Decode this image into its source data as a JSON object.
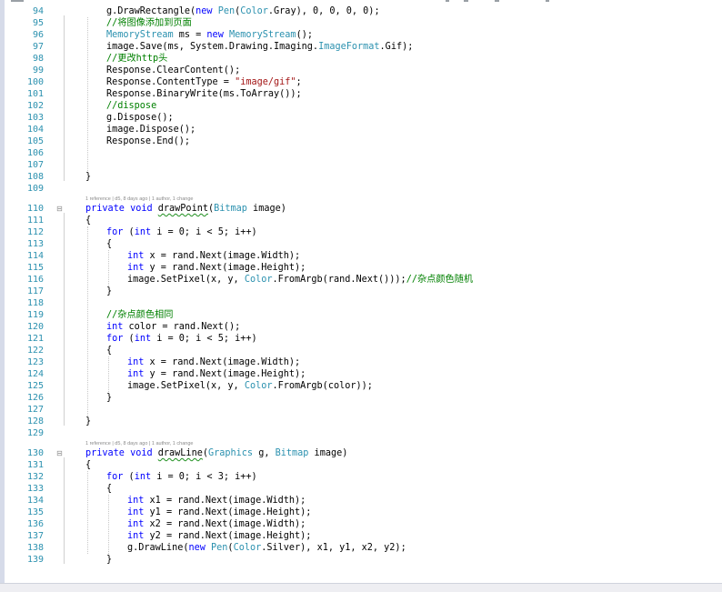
{
  "editor": {
    "lines": [
      {
        "n": "94",
        "indent": 2,
        "tokens": [
          {
            "t": "g.DrawRectangle("
          },
          {
            "t": "new",
            "c": "kw"
          },
          {
            "t": " "
          },
          {
            "t": "Pen",
            "c": "ty"
          },
          {
            "t": "("
          },
          {
            "t": "Color",
            "c": "ty"
          },
          {
            "t": ".Gray), 0, 0, 0, 0);"
          }
        ]
      },
      {
        "n": "95",
        "indent": 2,
        "tokens": [
          {
            "t": "//将图像添加到页面",
            "c": "cm"
          }
        ]
      },
      {
        "n": "96",
        "indent": 2,
        "tokens": [
          {
            "t": "MemoryStream",
            "c": "ty"
          },
          {
            "t": " ms = "
          },
          {
            "t": "new",
            "c": "kw"
          },
          {
            "t": " "
          },
          {
            "t": "MemoryStream",
            "c": "ty"
          },
          {
            "t": "();"
          }
        ]
      },
      {
        "n": "97",
        "indent": 2,
        "tokens": [
          {
            "t": "image.Save(ms, System.Drawing.Imaging."
          },
          {
            "t": "ImageFormat",
            "c": "ty"
          },
          {
            "t": ".Gif);"
          }
        ]
      },
      {
        "n": "98",
        "indent": 2,
        "tokens": [
          {
            "t": "//更改http头",
            "c": "cm"
          }
        ]
      },
      {
        "n": "99",
        "indent": 2,
        "tokens": [
          {
            "t": "Response.ClearContent();"
          }
        ]
      },
      {
        "n": "100",
        "indent": 2,
        "tokens": [
          {
            "t": "Response.ContentType = "
          },
          {
            "t": "\"image/gif\"",
            "c": "str"
          },
          {
            "t": ";"
          }
        ]
      },
      {
        "n": "101",
        "indent": 2,
        "tokens": [
          {
            "t": "Response.BinaryWrite(ms.ToArray());"
          }
        ]
      },
      {
        "n": "102",
        "indent": 2,
        "tokens": [
          {
            "t": "//dispose",
            "c": "cm"
          }
        ]
      },
      {
        "n": "103",
        "indent": 2,
        "tokens": [
          {
            "t": "g.Dispose();"
          }
        ]
      },
      {
        "n": "104",
        "indent": 2,
        "tokens": [
          {
            "t": "image.Dispose();"
          }
        ]
      },
      {
        "n": "105",
        "indent": 2,
        "tokens": [
          {
            "t": "Response.End();"
          }
        ]
      },
      {
        "n": "106",
        "indent": 0,
        "tokens": []
      },
      {
        "n": "107",
        "indent": 0,
        "tokens": []
      },
      {
        "n": "108",
        "indent": 1,
        "tokens": [
          {
            "t": "}"
          }
        ]
      },
      {
        "n": "109",
        "indent": 0,
        "tokens": []
      },
      {
        "n": "110",
        "indent": 1,
        "fold": "⊟",
        "lens": "1 reference | d5, 8 days ago | 1 author, 1 change",
        "tokens": [
          {
            "t": "private",
            "c": "kw"
          },
          {
            "t": " "
          },
          {
            "t": "void",
            "c": "kw"
          },
          {
            "t": " "
          },
          {
            "t": "drawPoint",
            "c": "sq-green"
          },
          {
            "t": "("
          },
          {
            "t": "Bitmap",
            "c": "ty"
          },
          {
            "t": " image)"
          }
        ]
      },
      {
        "n": "111",
        "indent": 1,
        "tokens": [
          {
            "t": "{"
          }
        ]
      },
      {
        "n": "112",
        "indent": 2,
        "tokens": [
          {
            "t": "for",
            "c": "kw"
          },
          {
            "t": " ("
          },
          {
            "t": "int",
            "c": "kw"
          },
          {
            "t": " i = 0; i < 5; i++)"
          }
        ]
      },
      {
        "n": "113",
        "indent": 2,
        "tokens": [
          {
            "t": "{"
          }
        ]
      },
      {
        "n": "114",
        "indent": 3,
        "tokens": [
          {
            "t": "int",
            "c": "kw"
          },
          {
            "t": " x = rand.Next(image.Width);"
          }
        ]
      },
      {
        "n": "115",
        "indent": 3,
        "tokens": [
          {
            "t": "int",
            "c": "kw"
          },
          {
            "t": " y = rand.Next(image.Height);"
          }
        ]
      },
      {
        "n": "116",
        "indent": 3,
        "tokens": [
          {
            "t": "image.SetPixel(x, y, "
          },
          {
            "t": "Color",
            "c": "ty"
          },
          {
            "t": ".FromArgb(rand.Next()));"
          },
          {
            "t": "//杂点颜色随机",
            "c": "cm"
          }
        ]
      },
      {
        "n": "117",
        "indent": 2,
        "tokens": [
          {
            "t": "}"
          }
        ]
      },
      {
        "n": "118",
        "indent": 0,
        "tokens": []
      },
      {
        "n": "119",
        "indent": 2,
        "tokens": [
          {
            "t": "//杂点颜色相同",
            "c": "cm"
          }
        ]
      },
      {
        "n": "120",
        "indent": 2,
        "tokens": [
          {
            "t": "int",
            "c": "kw"
          },
          {
            "t": " color = rand.Next();"
          }
        ]
      },
      {
        "n": "121",
        "indent": 2,
        "tokens": [
          {
            "t": "for",
            "c": "kw"
          },
          {
            "t": " ("
          },
          {
            "t": "int",
            "c": "kw"
          },
          {
            "t": " i = 0; i < 5; i++)"
          }
        ]
      },
      {
        "n": "122",
        "indent": 2,
        "tokens": [
          {
            "t": "{"
          }
        ]
      },
      {
        "n": "123",
        "indent": 3,
        "tokens": [
          {
            "t": "int",
            "c": "kw"
          },
          {
            "t": " x = rand.Next(image.Width);"
          }
        ]
      },
      {
        "n": "124",
        "indent": 3,
        "tokens": [
          {
            "t": "int",
            "c": "kw"
          },
          {
            "t": " y = rand.Next(image.Height);"
          }
        ]
      },
      {
        "n": "125",
        "indent": 3,
        "tokens": [
          {
            "t": "image.SetPixel(x, y, "
          },
          {
            "t": "Color",
            "c": "ty"
          },
          {
            "t": ".FromArgb(color));"
          }
        ]
      },
      {
        "n": "126",
        "indent": 2,
        "tokens": [
          {
            "t": "}"
          }
        ]
      },
      {
        "n": "127",
        "indent": 0,
        "tokens": []
      },
      {
        "n": "128",
        "indent": 1,
        "tokens": [
          {
            "t": "}"
          }
        ]
      },
      {
        "n": "129",
        "indent": 0,
        "tokens": []
      },
      {
        "n": "130",
        "indent": 1,
        "fold": "⊟",
        "lens": "1 reference | d5, 8 days ago | 1 author, 1 change",
        "tokens": [
          {
            "t": "private",
            "c": "kw"
          },
          {
            "t": " "
          },
          {
            "t": "void",
            "c": "kw"
          },
          {
            "t": " "
          },
          {
            "t": "drawLine",
            "c": "sq-green"
          },
          {
            "t": "("
          },
          {
            "t": "Graphics",
            "c": "ty"
          },
          {
            "t": " g, "
          },
          {
            "t": "Bitmap",
            "c": "ty"
          },
          {
            "t": " image)"
          }
        ]
      },
      {
        "n": "131",
        "indent": 1,
        "tokens": [
          {
            "t": "{"
          }
        ]
      },
      {
        "n": "132",
        "indent": 2,
        "tokens": [
          {
            "t": "for",
            "c": "kw"
          },
          {
            "t": " ("
          },
          {
            "t": "int",
            "c": "kw"
          },
          {
            "t": " i = 0; i < 3; i++)"
          }
        ]
      },
      {
        "n": "133",
        "indent": 2,
        "tokens": [
          {
            "t": "{"
          }
        ]
      },
      {
        "n": "134",
        "indent": 3,
        "tokens": [
          {
            "t": "int",
            "c": "kw"
          },
          {
            "t": " x1 = rand.Next(image.Width);"
          }
        ]
      },
      {
        "n": "135",
        "indent": 3,
        "tokens": [
          {
            "t": "int",
            "c": "kw"
          },
          {
            "t": " y1 = rand.Next(image.Height);"
          }
        ]
      },
      {
        "n": "136",
        "indent": 3,
        "tokens": [
          {
            "t": "int",
            "c": "kw"
          },
          {
            "t": " x2 = rand.Next(image.Width);"
          }
        ]
      },
      {
        "n": "137",
        "indent": 3,
        "tokens": [
          {
            "t": "int",
            "c": "kw"
          },
          {
            "t": " y2 = rand.Next(image.Height);"
          }
        ]
      },
      {
        "n": "138",
        "indent": 3,
        "tokens": [
          {
            "t": "g.DrawLine("
          },
          {
            "t": "new",
            "c": "kw"
          },
          {
            "t": " "
          },
          {
            "t": "Pen",
            "c": "ty"
          },
          {
            "t": "("
          },
          {
            "t": "Color",
            "c": "ty"
          },
          {
            "t": ".Silver), x1, y1, x2, y2);"
          }
        ]
      },
      {
        "n": "139",
        "indent": 2,
        "tokens": [
          {
            "t": "}"
          }
        ]
      }
    ]
  },
  "colors": {
    "keyword": "#0000ff",
    "type": "#2b91af",
    "string": "#a31515",
    "comment": "#008000",
    "line_number": "#2b91af"
  }
}
